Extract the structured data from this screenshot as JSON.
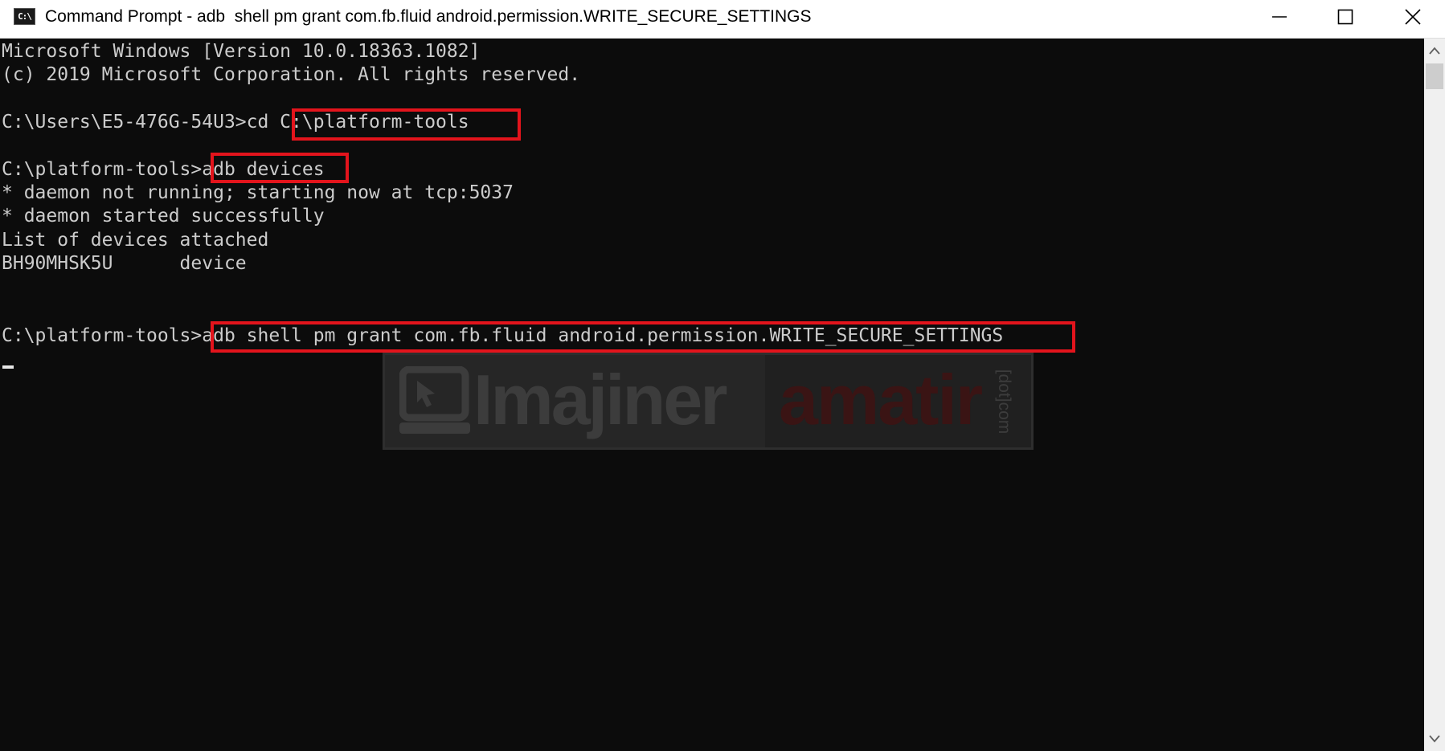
{
  "window": {
    "title": "Command Prompt - adb  shell pm grant com.fb.fluid android.permission.WRITE_SECURE_SETTINGS",
    "app_icon_text": "C:\\",
    "app_icon": "cmd-icon",
    "controls": {
      "minimize": "minimize-icon",
      "maximize": "maximize-icon",
      "close": "close-icon"
    }
  },
  "console": {
    "lines": [
      "Microsoft Windows [Version 10.0.18363.1082]",
      "(c) 2019 Microsoft Corporation. All rights reserved.",
      "",
      "C:\\Users\\E5-476G-54U3>cd C:\\platform-tools",
      "",
      "C:\\platform-tools>adb devices",
      "* daemon not running; starting now at tcp:5037",
      "* daemon started successfully",
      "List of devices attached",
      "BH90MHSK5U      device",
      "",
      "",
      "C:\\platform-tools>adb shell pm grant com.fb.fluid android.permission.WRITE_SECURE_SETTINGS"
    ],
    "highlight_color": "#e3141c",
    "text_color": "#cccccc",
    "background_color": "#0c0c0c"
  },
  "watermark": {
    "word1": "Imajiner",
    "word2": "amatir",
    "suffix": "[dot]com",
    "logo_icon": "monitor-cursor-icon"
  },
  "scrollbar": {
    "up_icon": "scroll-up-arrow-icon",
    "down_icon": "scroll-down-arrow-icon"
  }
}
